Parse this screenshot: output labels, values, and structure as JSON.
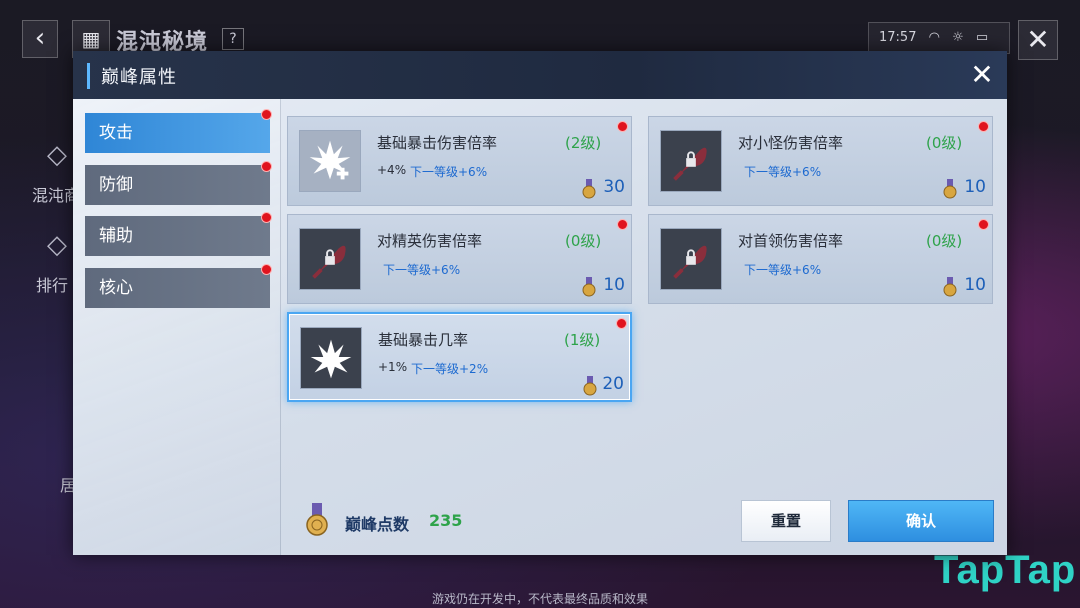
{
  "background": {
    "title": "混沌秘境",
    "help": "?",
    "status": {
      "time": "17:57"
    },
    "side_labels": [
      "混沌商",
      "排行"
    ],
    "side_partial": "居",
    "footer_note": "游戏仍在开发中，不代表最终品质和效果",
    "watermark": "TapTap"
  },
  "modal": {
    "title": "巅峰属性",
    "close_icon": "close-icon"
  },
  "sidebar": {
    "tabs": [
      {
        "label": "攻击",
        "active": true,
        "notify": true
      },
      {
        "label": "防御",
        "active": false,
        "notify": true
      },
      {
        "label": "辅助",
        "active": false,
        "notify": true
      },
      {
        "label": "核心",
        "active": false,
        "notify": true
      }
    ]
  },
  "attributes": [
    {
      "name": "基础暴击伤害倍率",
      "level": "(2级)",
      "current": "+4%",
      "next": "下一等级+6%",
      "cost": "30",
      "icon": "crit-damage-icon",
      "locked": false,
      "selected": false,
      "notify": true
    },
    {
      "name": "对小怪伤害倍率",
      "level": "(0级)",
      "current": "",
      "next": "下一等级+6%",
      "cost": "10",
      "icon": "locked-axe-icon",
      "locked": true,
      "selected": false,
      "notify": true
    },
    {
      "name": "对精英伤害倍率",
      "level": "(0级)",
      "current": "",
      "next": "下一等级+6%",
      "cost": "10",
      "icon": "locked-axe-icon",
      "locked": true,
      "selected": false,
      "notify": true
    },
    {
      "name": "对首领伤害倍率",
      "level": "(0级)",
      "current": "",
      "next": "下一等级+6%",
      "cost": "10",
      "icon": "locked-axe-icon",
      "locked": true,
      "selected": false,
      "notify": true
    },
    {
      "name": "基础暴击几率",
      "level": "(1级)",
      "current": "+1%",
      "next": "下一等级+2%",
      "cost": "20",
      "icon": "crit-chance-icon",
      "locked": false,
      "selected": true,
      "notify": true
    }
  ],
  "footer": {
    "points_label": "巅峰点数",
    "points_value": "235",
    "reset_label": "重置",
    "confirm_label": "确认"
  },
  "colors": {
    "level_green": "#2ea34a",
    "next_blue": "#1d6ad0",
    "active_tab": "#2f86d6",
    "notify_red": "#e0141e",
    "confirm_blue": "#3aa0ea"
  }
}
